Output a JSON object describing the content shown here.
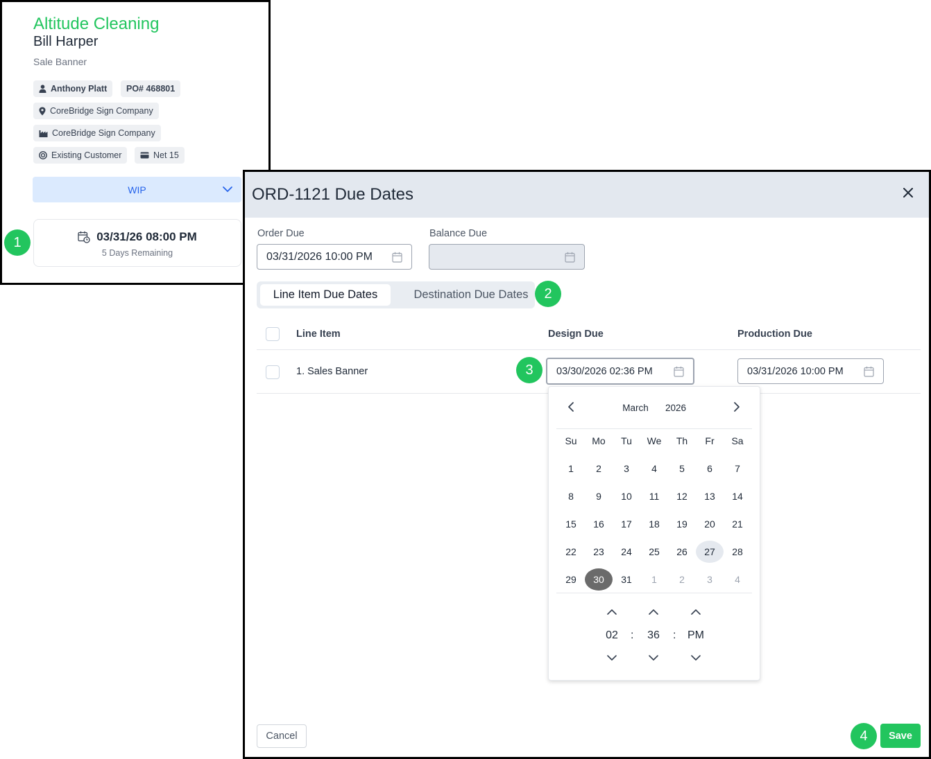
{
  "card": {
    "company": "Altitude Cleaning",
    "contact": "Bill Harper",
    "description": "Sale Banner",
    "salesperson": "Anthony Platt",
    "po": "PO# 468801",
    "location": "CoreBridge Sign Company",
    "facility": "CoreBridge Sign Company",
    "customer_type": "Existing Customer",
    "terms": "Net 15",
    "status": "WIP",
    "due_datetime": "03/31/26 08:00 PM",
    "days_remaining": "5 Days Remaining"
  },
  "callouts": [
    "1",
    "2",
    "3",
    "4"
  ],
  "modal": {
    "title": "ORD-1121 Due Dates",
    "order_due_label": "Order Due",
    "order_due_value": "03/31/2026 10:00 PM",
    "balance_due_label": "Balance Due",
    "balance_due_value": "",
    "tabs": [
      {
        "label": "Line Item Due Dates",
        "active": true
      },
      {
        "label": "Destination Due Dates",
        "active": false
      }
    ],
    "table": {
      "headers": [
        "Line Item",
        "Design Due",
        "Production Due"
      ],
      "rows": [
        {
          "line_item": "1. Sales Banner",
          "design_due": "03/30/2026 02:36 PM",
          "production_due": "03/31/2026 10:00 PM"
        }
      ]
    },
    "cancel_label": "Cancel",
    "save_label": "Save"
  },
  "datepicker": {
    "month": "March",
    "year": "2026",
    "weekdays": [
      "Su",
      "Mo",
      "Tu",
      "We",
      "Th",
      "Fr",
      "Sa"
    ],
    "weeks": [
      [
        "1",
        "2",
        "3",
        "4",
        "5",
        "6",
        "7"
      ],
      [
        "8",
        "9",
        "10",
        "11",
        "12",
        "13",
        "14"
      ],
      [
        "15",
        "16",
        "17",
        "18",
        "19",
        "20",
        "21"
      ],
      [
        "22",
        "23",
        "24",
        "25",
        "26",
        "27",
        "28"
      ],
      [
        "29",
        "30",
        "31",
        "1",
        "2",
        "3",
        "4"
      ]
    ],
    "today": "27",
    "selected": "30",
    "hour": "02",
    "minute": "36",
    "period": "PM",
    "time_separator": ":"
  },
  "colors": {
    "accent_green": "#22c55e",
    "status_bg": "#dbeafe",
    "status_text": "#2563eb",
    "selected_day": "#6b6b6b",
    "today_bg": "#e5e9ef"
  }
}
